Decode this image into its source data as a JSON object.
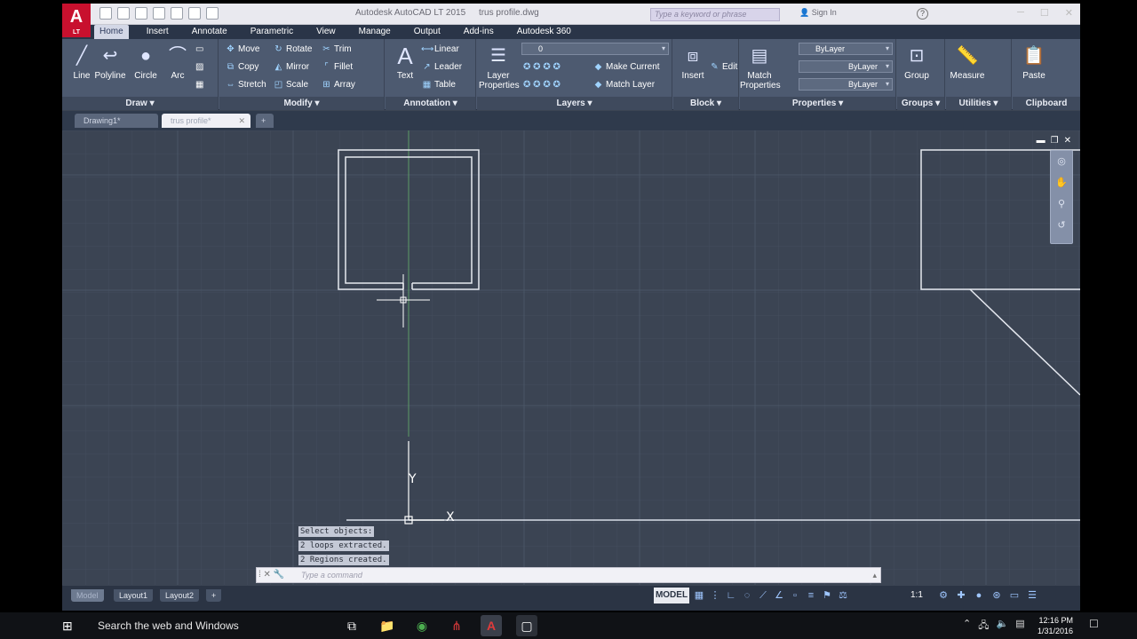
{
  "window": {
    "title_app": "Autodesk AutoCAD LT 2015",
    "title_file": "trus profile.dwg",
    "search_placeholder": "Type a keyword or phrase",
    "signin": "Sign In",
    "logo_label": "LT"
  },
  "ribbon_tabs": [
    "Home",
    "Insert",
    "Annotate",
    "Parametric",
    "View",
    "Manage",
    "Output",
    "Add-ins",
    "Autodesk 360"
  ],
  "panels": {
    "draw": {
      "title": "Draw ▾",
      "line": "Line",
      "polyline": "Polyline",
      "circle": "Circle",
      "arc": "Arc"
    },
    "modify": {
      "title": "Modify ▾",
      "move": "Move",
      "rotate": "Rotate",
      "trim": "Trim",
      "copy": "Copy",
      "mirror": "Mirror",
      "fillet": "Fillet",
      "stretch": "Stretch",
      "scale": "Scale",
      "array": "Array"
    },
    "annotation": {
      "title": "Annotation ▾",
      "text": "Text",
      "linear": "Linear",
      "leader": "Leader",
      "table": "Table"
    },
    "layers": {
      "title": "Layers ▾",
      "layer_properties": "Layer Properties",
      "layer_combo": "0",
      "make_current": "Make Current",
      "match_layer": "Match Layer"
    },
    "block": {
      "title": "Block ▾",
      "insert": "Insert",
      "edit": "Edit"
    },
    "properties": {
      "title": "Properties ▾",
      "match_properties": "Match Properties",
      "bylayer_color": "ByLayer",
      "bylayer_linetype": "ByLayer",
      "bylayer_lineweight": "ByLayer"
    },
    "groups": {
      "title": "Groups ▾",
      "group": "Group"
    },
    "utilities": {
      "title": "Utilities ▾",
      "measure": "Measure"
    },
    "clipboard": {
      "title": "Clipboard",
      "paste": "Paste"
    }
  },
  "doc_tabs": [
    "Drawing1*",
    "trus profile*"
  ],
  "command": {
    "history": [
      "Select objects:",
      "2 loops extracted.",
      "2 Regions created."
    ],
    "placeholder": "Type a command"
  },
  "axis_labels": {
    "x": "X",
    "y": "Y"
  },
  "layout_tabs": [
    "Model",
    "Layout1",
    "Layout2"
  ],
  "status": {
    "model": "MODEL",
    "scale": "1:1"
  },
  "taskbar": {
    "search": "Search the web and Windows",
    "time": "12:16 PM",
    "date": "1/31/2016"
  }
}
